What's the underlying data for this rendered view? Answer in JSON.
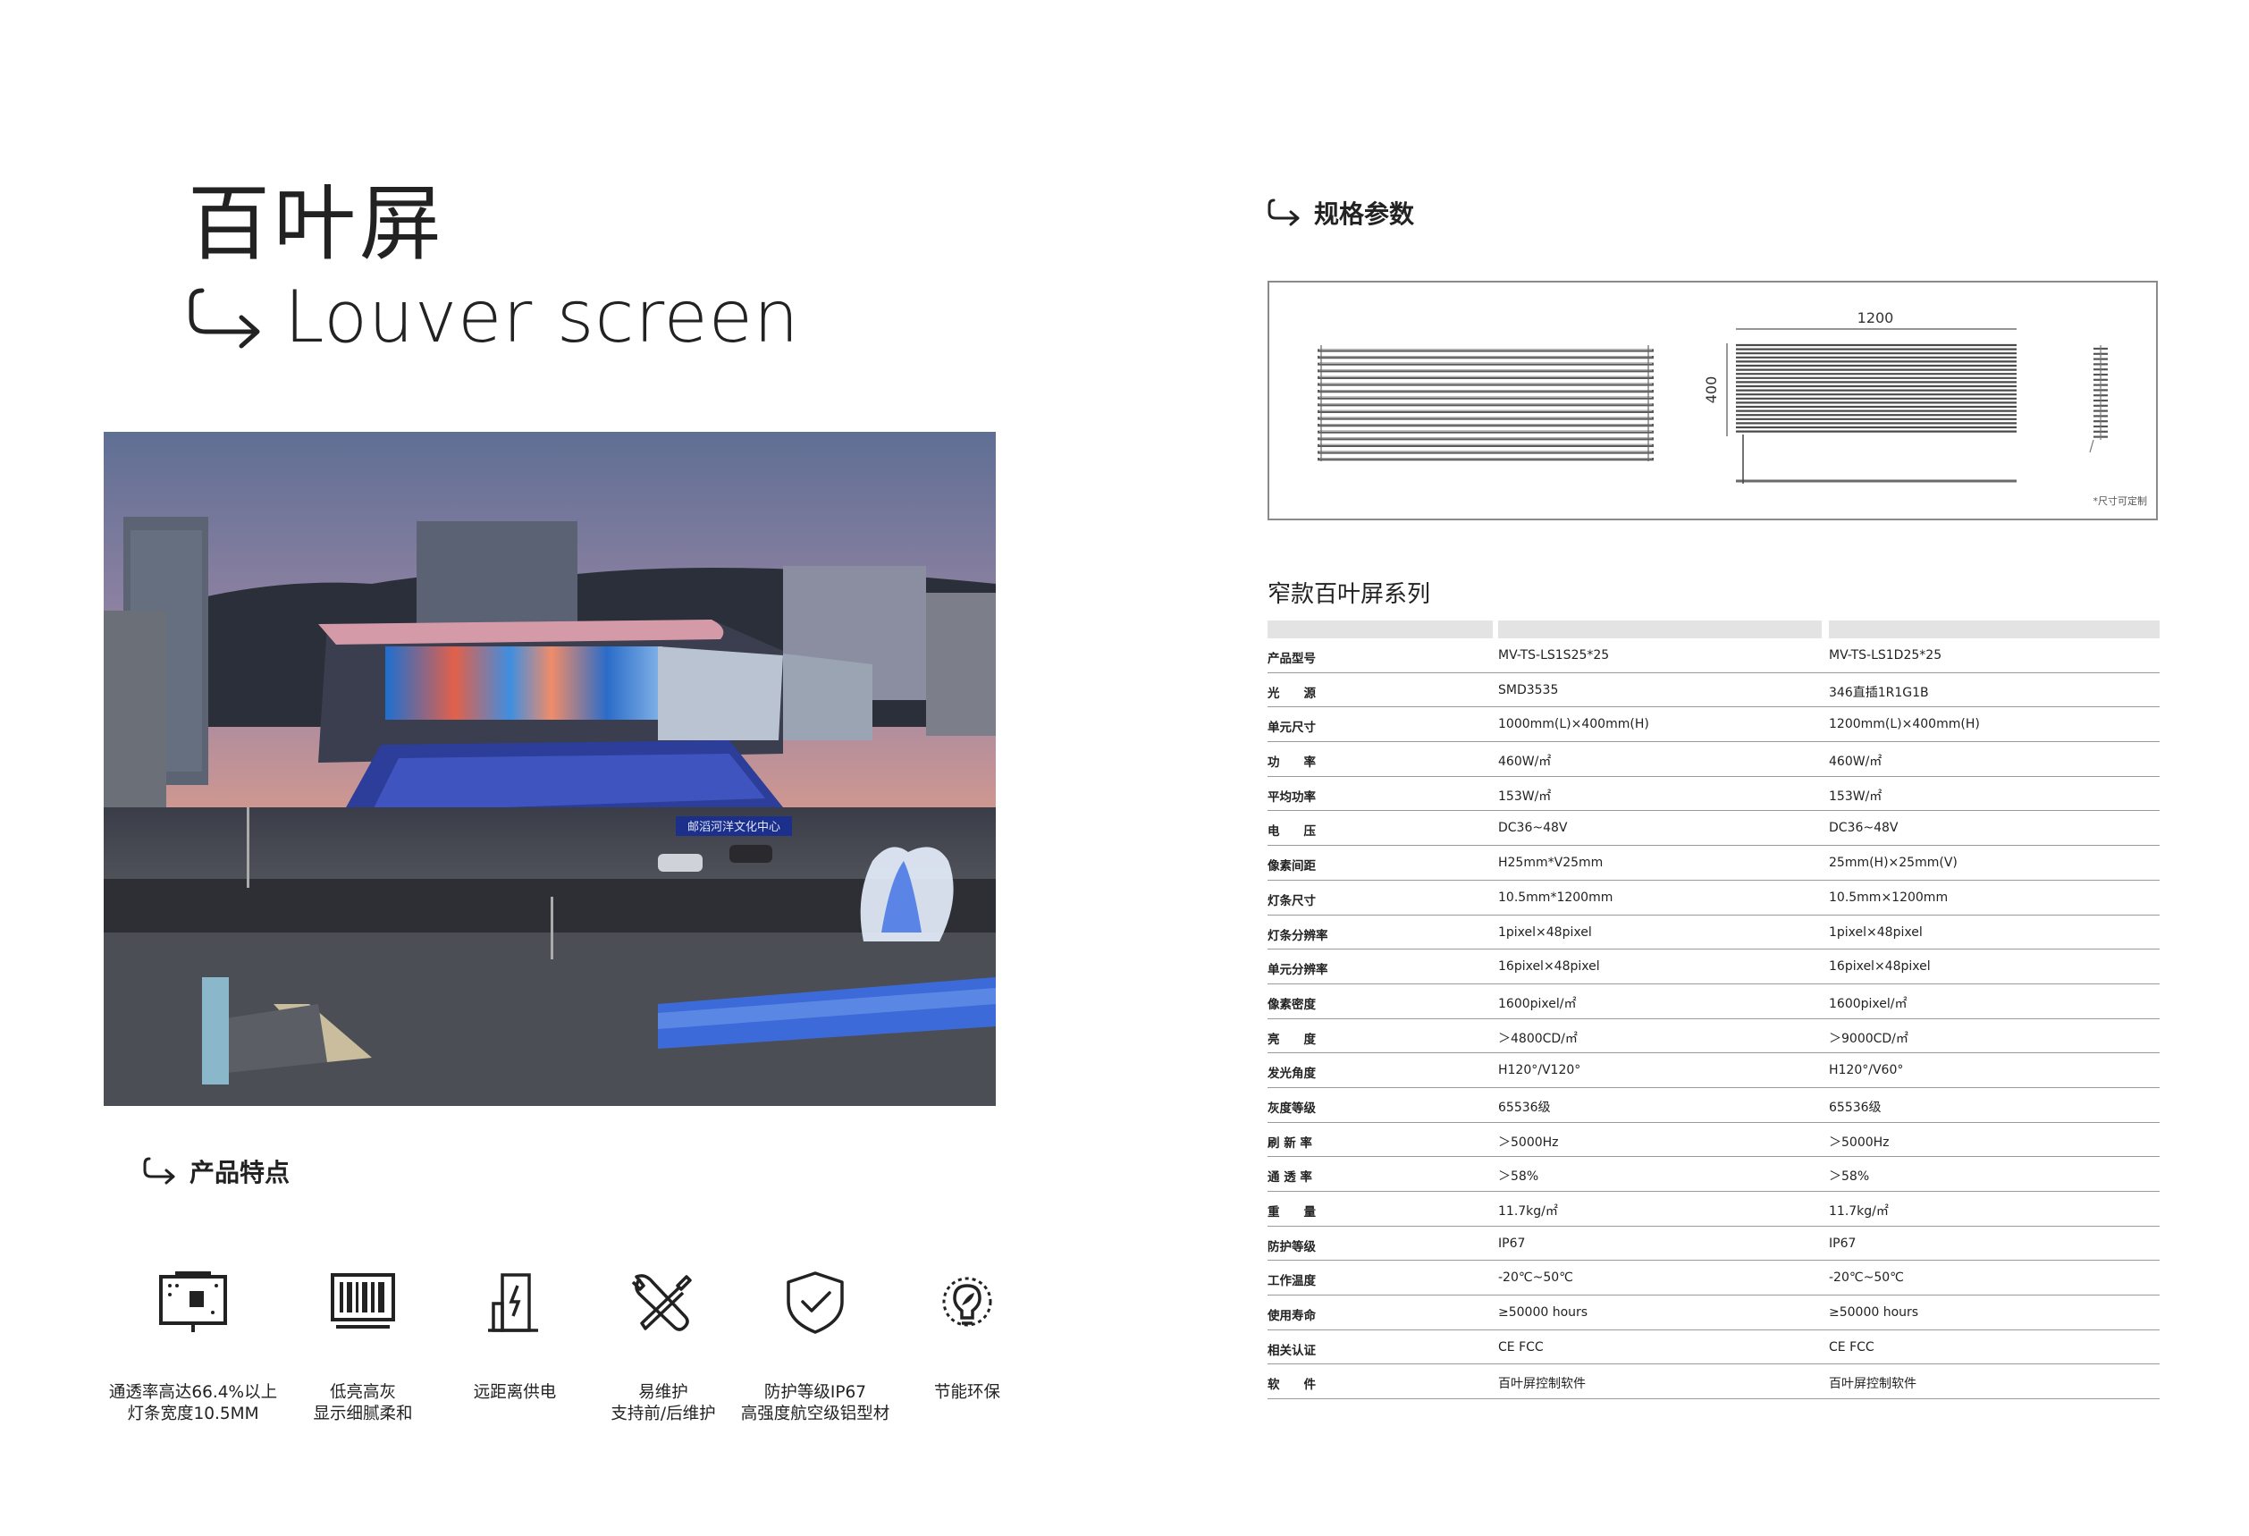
{
  "page": {
    "title_cn": "百叶屏",
    "title_en": "Louver screen"
  },
  "features_section": {
    "heading": "产品特点",
    "items": [
      {
        "icon": "transparent-display-icon",
        "lines": [
          "通透率高达66.4%以上",
          "灯条宽度10.5MM"
        ]
      },
      {
        "icon": "barcode-display-icon",
        "lines": [
          "低亮高灰",
          "显示细腻柔和"
        ]
      },
      {
        "icon": "building-power-icon",
        "lines": [
          "远距离供电",
          ""
        ]
      },
      {
        "icon": "tools-icon",
        "lines": [
          "易维护",
          "支持前/后维护"
        ]
      },
      {
        "icon": "shield-check-icon",
        "lines": [
          "防护等级IP67",
          "高强度航空级铝型材"
        ]
      },
      {
        "icon": "energy-bulb-icon",
        "lines": [
          "节能环保",
          ""
        ]
      }
    ]
  },
  "spec_section": {
    "heading": "规格参数",
    "drawing": {
      "width_label": "1200",
      "height_label": "400",
      "note": "*尺寸可定制"
    },
    "series_title": "窄款百叶屏系列",
    "rows": [
      {
        "label": "产品型号",
        "a": "MV-TS-LS1S25*25",
        "b": "MV-TS-LS1D25*25"
      },
      {
        "label": "光　　源",
        "a": "SMD3535",
        "b": "346直插1R1G1B"
      },
      {
        "label": "单元尺寸",
        "a": "1000mm(L)×400mm(H)",
        "b": "1200mm(L)×400mm(H)"
      },
      {
        "label": "功　　率",
        "a": "460W/㎡",
        "b": "460W/㎡"
      },
      {
        "label": "平均功率",
        "a": "153W/㎡",
        "b": "153W/㎡"
      },
      {
        "label": "电　　压",
        "a": "DC36~48V",
        "b": "DC36~48V"
      },
      {
        "label": "像素间距",
        "a": "H25mm*V25mm",
        "b": "25mm(H)×25mm(V)"
      },
      {
        "label": "灯条尺寸",
        "a": "10.5mm*1200mm",
        "b": "10.5mm×1200mm"
      },
      {
        "label": "灯条分辨率",
        "a": "1pixel×48pixel",
        "b": "1pixel×48pixel"
      },
      {
        "label": "单元分辨率",
        "a": "16pixel×48pixel",
        "b": "16pixel×48pixel"
      },
      {
        "label": "像素密度",
        "a": "1600pixel/㎡",
        "b": "1600pixel/㎡"
      },
      {
        "label": "亮　　度",
        "a": "＞4800CD/㎡",
        "b": "＞9000CD/㎡"
      },
      {
        "label": "发光角度",
        "a": "H120°/V120°",
        "b": "H120°/V60°"
      },
      {
        "label": "灰度等级",
        "a": "65536级",
        "b": "65536级"
      },
      {
        "label": "刷 新 率",
        "a": "＞5000Hz",
        "b": "＞5000Hz"
      },
      {
        "label": "通 透 率",
        "a": "＞58%",
        "b": "＞58%"
      },
      {
        "label": "重　　量",
        "a": "11.7kg/㎡",
        "b": "11.7kg/㎡"
      },
      {
        "label": "防护等级",
        "a": "IP67",
        "b": "IP67"
      },
      {
        "label": "工作温度",
        "a": "-20℃~50℃",
        "b": "-20℃~50℃"
      },
      {
        "label": "使用寿命",
        "a": "≥50000 hours",
        "b": "≥50000 hours"
      },
      {
        "label": "相关认证",
        "a": "CE FCC",
        "b": "CE FCC"
      },
      {
        "label": "软　　件",
        "a": "百叶屏控制软件",
        "b": "百叶屏控制软件"
      }
    ]
  },
  "photo": {
    "sign_text": "邮滔河洋文化中心"
  },
  "colors": {
    "text": "#1e1e1e",
    "rule": "#9a9a9a",
    "header_bar": "#e3e3e3",
    "box_border": "#8a8a8a"
  }
}
